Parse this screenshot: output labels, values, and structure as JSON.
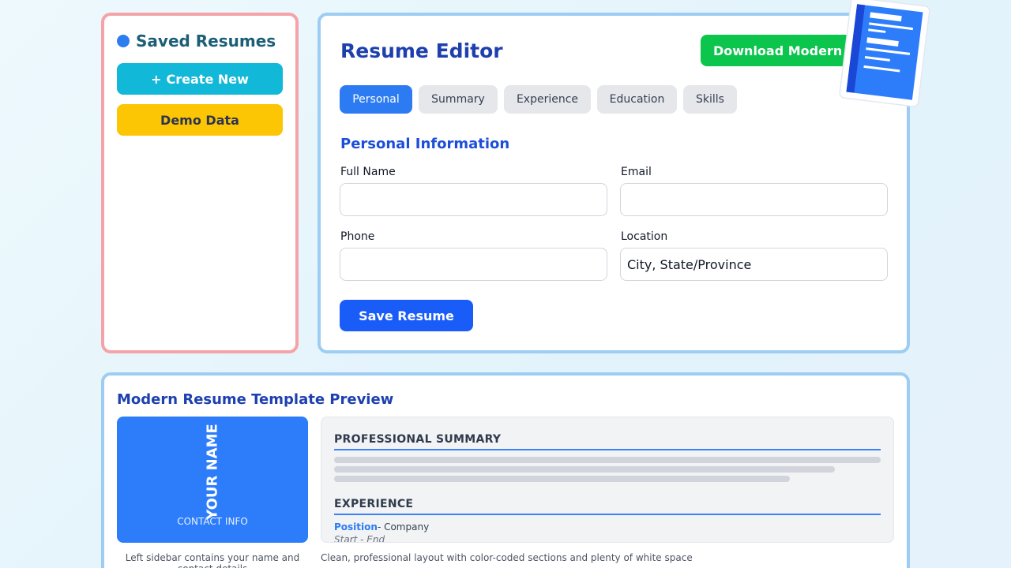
{
  "saved": {
    "title": "Saved Resumes",
    "create_icon": "+",
    "create_label": "Create New",
    "demo_label": "Demo Data"
  },
  "editor": {
    "title": "Resume Editor",
    "download_label": "Download Modern",
    "tabs": [
      {
        "label": "Personal",
        "active": true
      },
      {
        "label": "Summary",
        "active": false
      },
      {
        "label": "Experience",
        "active": false
      },
      {
        "label": "Education",
        "active": false
      },
      {
        "label": "Skills",
        "active": false
      }
    ],
    "section_heading": "Personal Information",
    "fields": {
      "full_name": {
        "label": "Full Name",
        "value": "",
        "placeholder": ""
      },
      "email": {
        "label": "Email",
        "value": "",
        "placeholder": ""
      },
      "phone": {
        "label": "Phone",
        "value": "",
        "placeholder": ""
      },
      "location": {
        "label": "Location",
        "value": "",
        "placeholder": "City, State/Province"
      }
    },
    "save_label": "Save Resume"
  },
  "preview": {
    "title": "Modern Resume Template Preview",
    "sidebar_name": "YOUR NAME",
    "sidebar_contact": "CONTACT INFO",
    "summary_heading": "PROFESSIONAL SUMMARY",
    "experience_heading": "EXPERIENCE",
    "position": "Position",
    "company": "- Company",
    "dates": "Start - End",
    "caption_left": "Left sidebar contains your name and contact details",
    "caption_right": "Clean, professional layout with color-coded sections and plenty of white space"
  },
  "icons": {
    "saved_dot": "dot-icon",
    "document": "document-icon"
  },
  "colors": {
    "accent_blue": "#2d7bf2",
    "create_cyan": "#12b8d8",
    "demo_yellow": "#fcc605",
    "download_green": "#0cc54c",
    "save_blue": "#1a5cf8",
    "saved_border": "#f4a4a8",
    "panel_border": "#9ecdf3"
  }
}
